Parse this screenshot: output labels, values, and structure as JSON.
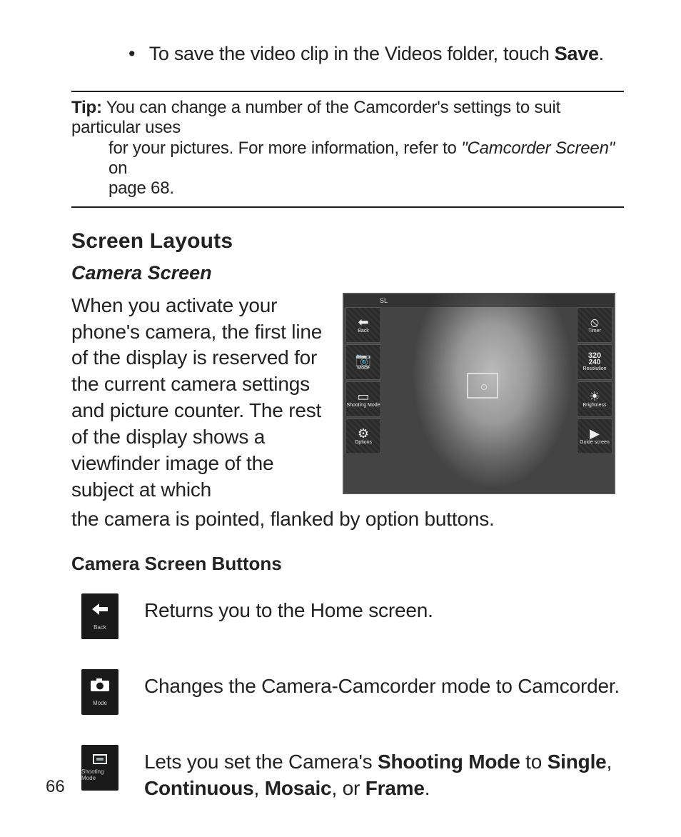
{
  "bullet": {
    "pre": "To save the video clip in the Videos folder, touch ",
    "bold": "Save",
    "post": "."
  },
  "tip": {
    "label": "Tip:",
    "line1": " You can change a number of the Camcorder's settings to suit particular uses",
    "line2": "for your pictures. For more information, refer to ",
    "ref": "\"Camcorder Screen\"",
    "line2b": "  on",
    "line3": "page 68."
  },
  "headings": {
    "h1": "Screen Layouts",
    "h2": "Camera Screen",
    "h3": "Camera Screen Buttons"
  },
  "para": {
    "wrap": "When you activate your phone's camera, the first line of the display is reserved for the current camera settings and picture counter. The rest of the display shows a viewfinder image of the subject at which",
    "full": "the camera is pointed, flanked by option buttons."
  },
  "screenshot": {
    "status_left": "SL",
    "status_right": "",
    "left": [
      {
        "icon": "⬅",
        "label": "Back"
      },
      {
        "icon": "📷",
        "label": "Mode"
      },
      {
        "icon": "▭",
        "label": "Shooting Mode"
      },
      {
        "icon": "⚙",
        "label": "Options"
      }
    ],
    "right": [
      {
        "icon": "⦸",
        "label": "Timer"
      },
      {
        "icon": "320",
        "label": "Resolution",
        "sub": "240"
      },
      {
        "icon": "☀",
        "label": "Brightness"
      },
      {
        "icon": "▶",
        "label": "Guide screen"
      }
    ]
  },
  "buttons": [
    {
      "icon": "back",
      "cap": "Back",
      "desc_pre": "Returns you to the Home screen.",
      "desc_segments": []
    },
    {
      "icon": "camera",
      "cap": "Mode",
      "desc_pre": "Changes the Camera-Camcorder mode to Camcorder.",
      "desc_segments": []
    },
    {
      "icon": "shoot",
      "cap": "Shooting Mode",
      "desc_pre": "Lets you set the Camera's ",
      "desc_segments": [
        {
          "t": "Shooting Mode",
          "b": true
        },
        {
          "t": " to ",
          "b": false
        },
        {
          "t": "Single",
          "b": true
        },
        {
          "t": ", ",
          "b": false
        },
        {
          "t": "Continuous",
          "b": true
        },
        {
          "t": ", ",
          "b": false
        },
        {
          "t": "Mosaic",
          "b": true
        },
        {
          "t": ", or ",
          "b": false
        },
        {
          "t": "Frame",
          "b": true
        },
        {
          "t": ".",
          "b": false
        }
      ]
    }
  ],
  "pagenum": "66"
}
